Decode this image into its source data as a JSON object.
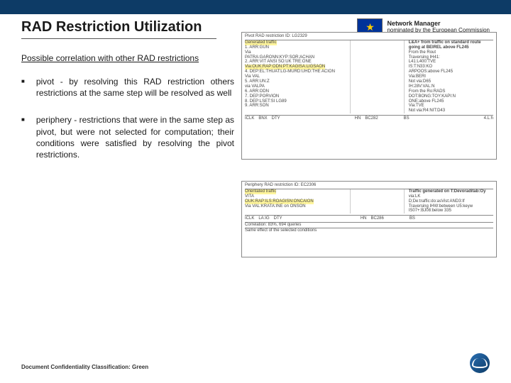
{
  "header": {
    "title": "RAD Restriction Utilization",
    "nm_line1": "Network Manager",
    "nm_line2": "nominated by the European Commission"
  },
  "content": {
    "subtitle": "Possible correlation with other RAD restrictions",
    "bullets": [
      "pivot - by resolving this RAD restriction others restrictions at the same step will be resolved as well",
      "periphery - restrictions that were in the same step as pivot, but were not selected for computation; their conditions were satisfied by resolving the pivot restrictions."
    ]
  },
  "diagram": {
    "box1_title": "Pivot RAD restriction ID: LG2329",
    "box1_hl1": "Generated traffic",
    "box1_lines1": [
      "1. ARR:GUN",
      "Via",
      "PATRA:GARONN:KYP:SOR:ACHAN",
      "2. ARR:VIT ANSI SO:UK TRE:ONE"
    ],
    "box1_hl2": "Via:OUK:RAP:ODN:PT:KAGISA:LIGSAON",
    "box1_lines2": [
      "4. DEP:EL:THUAT:LG-MURD:UHD:THE ACION",
      "Via VAL",
      "5. ARR:UN:Z",
      "via VALPA",
      "6. ARR:ODN",
      "7. DEP:PORVION",
      "8. DEP:LSET:SI LG89",
      "9. ARR:SON"
    ],
    "box1_right_lead": "L&A+ from traffic on standard route going at BEIREL above FL245",
    "box1_right": [
      "From the Rout",
      "Traversing IH41:",
      "L41:L400:TVE",
      "IS:T:N33:KO",
      "ARPOOS:above FL245",
      "Via:BERI",
      "Not via:D65",
      "IH:28V:VAL:N",
      "From the Ro:RADS",
      "DOT:BONG:TOY:KAPI:N",
      "ONE:above FL245",
      "Via:TVE",
      "Not via:R4:NIT:D43"
    ],
    "box1_footer_left": "ICLK BNX DTY",
    "box1_footer_right": "HN BC282      BS",
    "box1_footer_far": "4.L:h",
    "box2_title": "Periphery RAD restriction ID: EC2306",
    "box2_hl1": "Orientated traffic",
    "box2_line1": "VITA",
    "box2_hl2": "OUK:RAP:ILS:ROAGISN:ONCAION",
    "box2_line2": "Via VAL:KRATA:INE on ONSON",
    "box2_right_lead": "Traffic generated on T:Devoraditab:Oy",
    "box2_right": [
      "via:LK",
      "D;De:traffic:do:asVist:AND3:If",
      "Traversing IHW:between U5:keyw",
      "IS07+:BJ08:below 335"
    ],
    "box2_footer_left": "ICLK LA:IG DTY",
    "box2_footer_right": "HN BC286      BS",
    "correlation": "Correlation: 83%, 694 queries",
    "same_effect": "Same effect of the selected conditions"
  },
  "footer": {
    "classification": "Document Confidentiality Classification: Green"
  }
}
